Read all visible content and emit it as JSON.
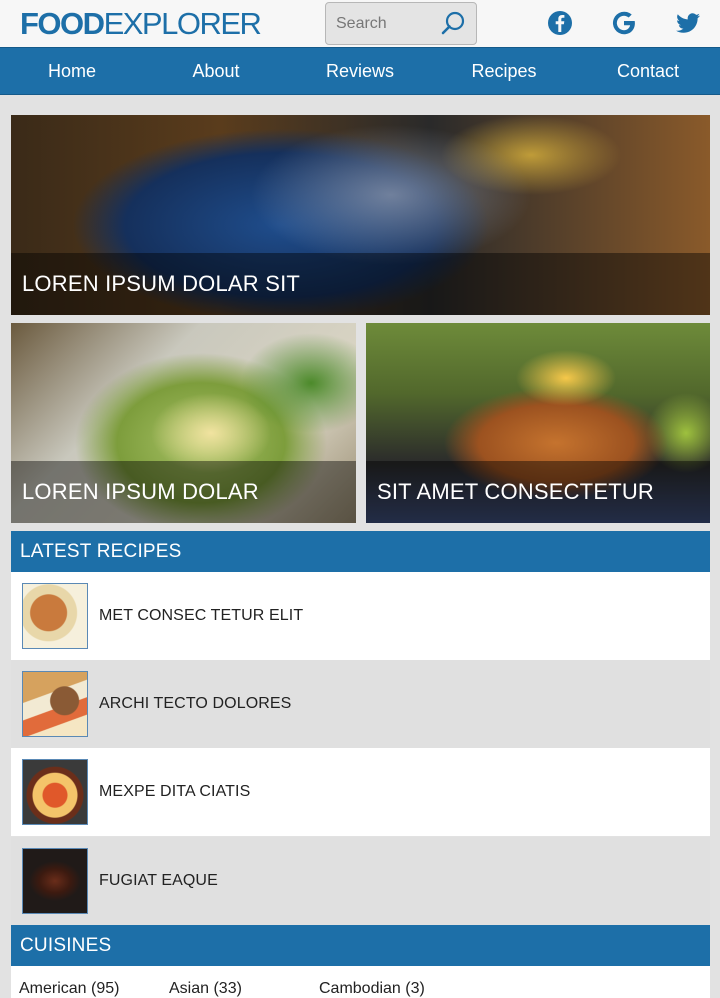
{
  "header": {
    "logo_bold": "FOOD",
    "logo_light": "EXPLORER",
    "search_placeholder": "Search",
    "social": [
      "facebook-icon",
      "google-icon",
      "twitter-icon"
    ]
  },
  "nav": {
    "items": [
      "Home",
      "About",
      "Reviews",
      "Recipes",
      "Contact"
    ]
  },
  "featured": {
    "main_caption": "LOREN IPSUM DOLAR SIT",
    "left_caption": "LOREN IPSUM DOLAR",
    "right_caption": "SIT AMET CONSECTETUR"
  },
  "latest_recipes": {
    "heading": "LATEST RECIPES",
    "items": [
      "MET CONSEC TETUR ELIT",
      "ARCHI TECTO DOLORES",
      "MEXPE DITA CIATIS",
      "FUGIAT EAQUE"
    ]
  },
  "cuisines": {
    "heading": "CUISINES",
    "items": [
      "American (95)",
      "Asian (33)",
      "Cambodian (3)"
    ]
  },
  "colors": {
    "brand_blue": "#1d6fa8",
    "background": "#e2e2e2"
  }
}
